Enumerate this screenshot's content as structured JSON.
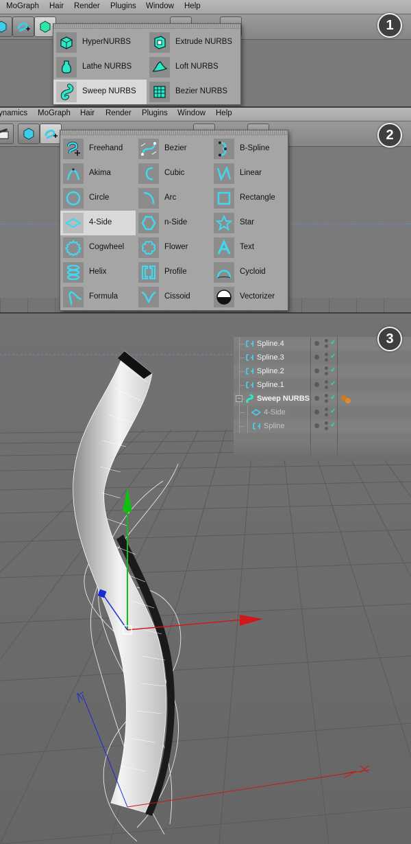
{
  "badges": [
    "1",
    "2",
    "3"
  ],
  "menubar1": [
    "MoGraph",
    "Hair",
    "Render",
    "Plugins",
    "Window",
    "Help"
  ],
  "menubar2": [
    "ynamics",
    "MoGraph",
    "Hair",
    "Render",
    "Plugins",
    "Window",
    "Help"
  ],
  "nurbs_menu": [
    {
      "label": "HyperNURBS",
      "icon": "hypernurbs-icon"
    },
    {
      "label": "Extrude NURBS",
      "icon": "extrude-nurbs-icon"
    },
    {
      "label": "Lathe NURBS",
      "icon": "lathe-nurbs-icon"
    },
    {
      "label": "Loft NURBS",
      "icon": "loft-nurbs-icon"
    },
    {
      "label": "Sweep NURBS",
      "icon": "sweep-nurbs-icon",
      "selected": true
    },
    {
      "label": "Bezier NURBS",
      "icon": "bezier-nurbs-icon"
    }
  ],
  "spline_menu": [
    {
      "label": "Freehand",
      "icon": "freehand-icon"
    },
    {
      "label": "Bezier",
      "icon": "bezier-icon"
    },
    {
      "label": "B-Spline",
      "icon": "b-spline-icon"
    },
    {
      "label": "Akima",
      "icon": "akima-icon"
    },
    {
      "label": "Cubic",
      "icon": "cubic-icon"
    },
    {
      "label": "Linear",
      "icon": "linear-icon"
    },
    {
      "label": "Circle",
      "icon": "circle-icon"
    },
    {
      "label": "Arc",
      "icon": "arc-icon"
    },
    {
      "label": "Rectangle",
      "icon": "rectangle-icon"
    },
    {
      "label": "4-Side",
      "icon": "four-side-icon",
      "selected": true
    },
    {
      "label": "n-Side",
      "icon": "n-side-icon"
    },
    {
      "label": "Star",
      "icon": "star-icon"
    },
    {
      "label": "Cogwheel",
      "icon": "cogwheel-icon"
    },
    {
      "label": "Flower",
      "icon": "flower-icon"
    },
    {
      "label": "Text",
      "icon": "text-icon"
    },
    {
      "label": "Helix",
      "icon": "helix-icon"
    },
    {
      "label": "Profile",
      "icon": "profile-icon"
    },
    {
      "label": "Cycloid",
      "icon": "cycloid-icon"
    },
    {
      "label": "Formula",
      "icon": "formula-icon"
    },
    {
      "label": "Cissoid",
      "icon": "cissoid-icon"
    },
    {
      "label": "Vectorizer",
      "icon": "vectorizer-icon"
    }
  ],
  "object_manager": [
    {
      "name": "Spline.4",
      "icon": "spline-icon"
    },
    {
      "name": "Spline.3",
      "icon": "spline-icon"
    },
    {
      "name": "Spline.2",
      "icon": "spline-icon"
    },
    {
      "name": "Spline.1",
      "icon": "spline-icon"
    },
    {
      "name": "Sweep NURBS",
      "icon": "sweep-nurbs-icon",
      "expanded": true
    },
    {
      "name": "4-Side",
      "icon": "four-side-icon",
      "child": true
    },
    {
      "name": "Spline",
      "icon": "spline-icon",
      "child": true
    }
  ],
  "colors": {
    "accent": "#2ee6c8",
    "icon_cyan": "#40d8f0",
    "check": "#33e08a",
    "axis_x": "#d01818",
    "axis_y": "#10c010",
    "axis_z": "#1a2ad8"
  }
}
